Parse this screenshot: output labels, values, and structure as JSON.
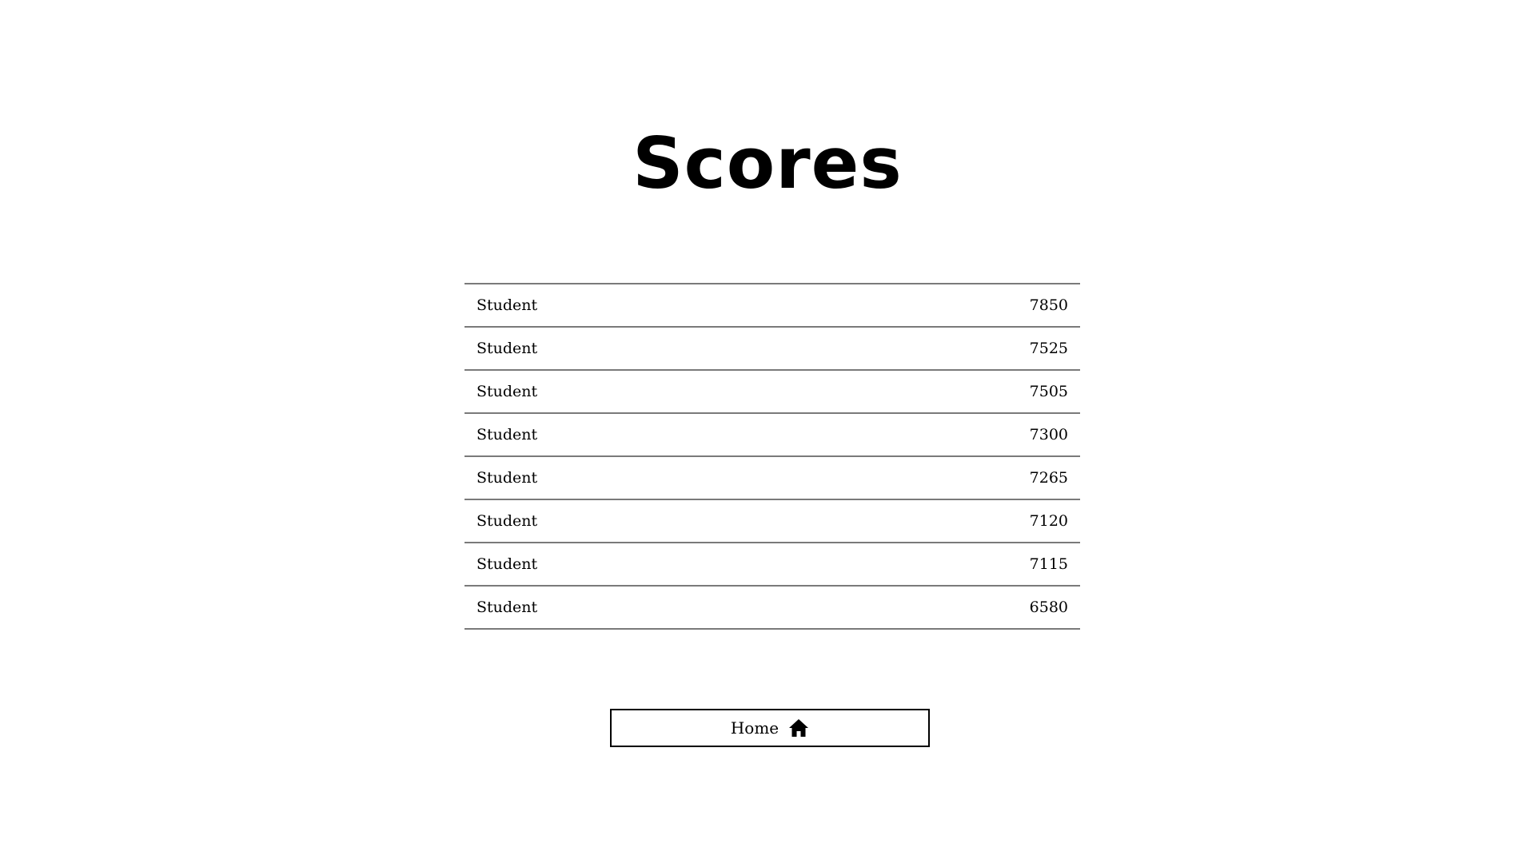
{
  "header": {
    "title": "Scores"
  },
  "scores": [
    {
      "name": "Student",
      "score": "7850"
    },
    {
      "name": "Student",
      "score": "7525"
    },
    {
      "name": "Student",
      "score": "7505"
    },
    {
      "name": "Student",
      "score": "7300"
    },
    {
      "name": "Student",
      "score": "7265"
    },
    {
      "name": "Student",
      "score": "7120"
    },
    {
      "name": "Student",
      "score": "7115"
    },
    {
      "name": "Student",
      "score": "6580"
    }
  ],
  "footer": {
    "home_label": "Home",
    "home_icon": "home-icon"
  },
  "colors": {
    "background": "#ffffff",
    "text": "#000000",
    "divider": "#7a7a7a"
  }
}
